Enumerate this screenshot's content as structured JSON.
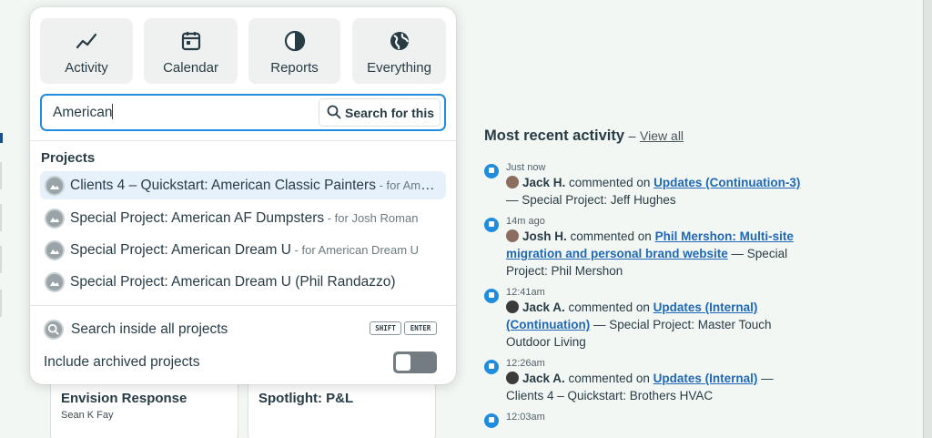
{
  "quick_nav": [
    {
      "label": "Activity",
      "icon": "activity-icon"
    },
    {
      "label": "Calendar",
      "icon": "calendar-icon"
    },
    {
      "label": "Reports",
      "icon": "reports-icon"
    },
    {
      "label": "Everything",
      "icon": "everything-icon"
    }
  ],
  "search": {
    "value": "American",
    "button_label": "Search for this"
  },
  "projects": {
    "heading": "Projects",
    "results": [
      {
        "name": "Clients 4 – Quickstart: American Classic Painters",
        "for": " - for American Classic Painters"
      },
      {
        "name": "Special Project: American AF Dumpsters",
        "for": " - for Josh Roman"
      },
      {
        "name": "Special Project: American Dream U",
        "for": " - for American Dream U"
      },
      {
        "name": "Special Project: American Dream U (Phil Randazzo)",
        "for": ""
      }
    ]
  },
  "footer": {
    "search_all": "Search inside all projects",
    "shortcut_keys": [
      "SHIFT",
      "ENTER"
    ],
    "archived_label": "Include archived projects",
    "archived_enabled": false
  },
  "background_cards": [
    {
      "title": "Envision Response",
      "subtitle": "Sean K Fay"
    },
    {
      "title": "Spotlight: P&L",
      "subtitle": ""
    }
  ],
  "activity": {
    "heading": "Most recent activity",
    "dash": "–",
    "view_all": "View all",
    "items": [
      {
        "time": "Just now",
        "who": "Jack H.",
        "verb": " commented on ",
        "link": "Updates (Continuation-3)",
        "rest": " — Special Project: Jeff Hughes"
      },
      {
        "time": "14m ago",
        "who": "Josh H.",
        "verb": " commented on ",
        "link": "Phil Mershon: Multi-site migration and personal brand website",
        "rest": " — Special Project: Phil Mershon"
      },
      {
        "time": "12:41am",
        "who": "Jack A.",
        "verb": " commented on ",
        "link": "Updates (Internal) (Continuation)",
        "rest": " — Special Project: Master Touch Outdoor Living"
      },
      {
        "time": "12:26am",
        "who": "Jack A.",
        "verb": " commented on ",
        "link": "Updates (Internal)",
        "rest": " — Clients 4 – Quickstart: Brothers HVAC"
      },
      {
        "time": "12:03am",
        "who": "",
        "verb": "",
        "link": "",
        "rest": ""
      }
    ]
  },
  "colors": {
    "accent": "#1f8cde",
    "link": "#1f68b8",
    "highlight": "#e7f1fb",
    "page_bg": "#f3f7f4"
  }
}
